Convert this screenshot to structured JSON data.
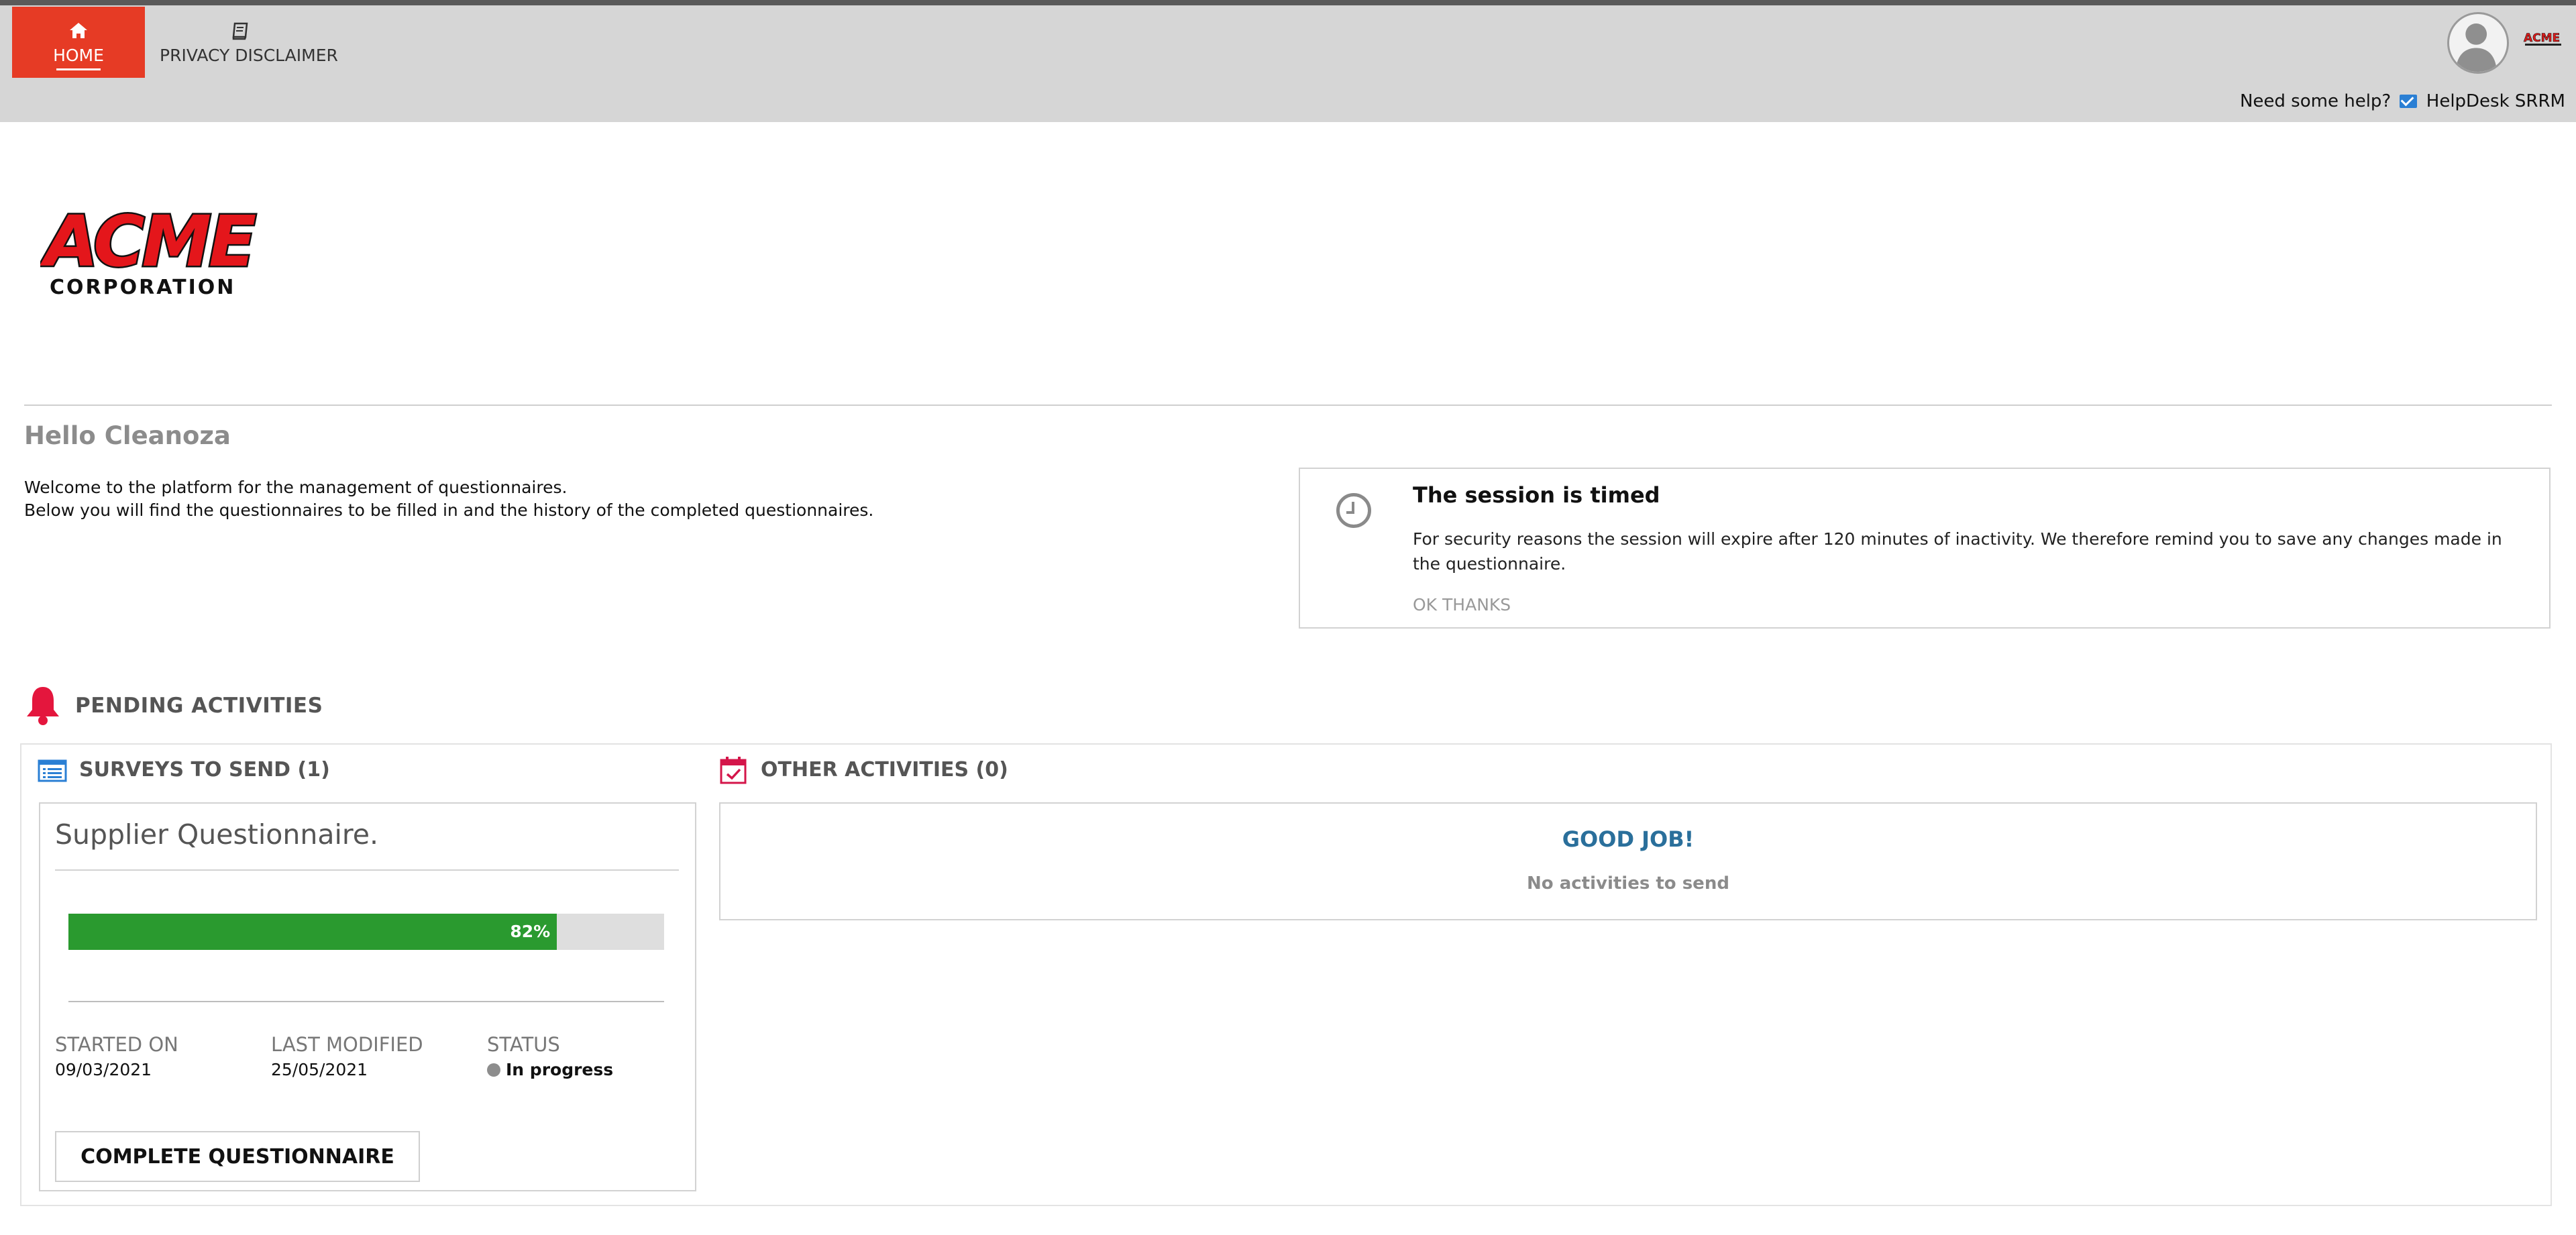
{
  "nav": {
    "home_label": "HOME",
    "privacy_label": "PRIVACY DISCLAIMER"
  },
  "header": {
    "help_text": "Need some help?",
    "helpdesk_label": "HelpDesk SRRM"
  },
  "brand": {
    "logo_line1": "ACME",
    "logo_line2": "CORPORATION",
    "accent": "#e63b25"
  },
  "greeting": {
    "hello": "Hello Cleanoza",
    "line1": "Welcome to the platform for the management of questionnaires.",
    "line2": "Below you will find the questionnaires to be filled in and the history of the completed questionnaires."
  },
  "session": {
    "title": "The session is timed",
    "text": "For security reasons the session will expire after 120 minutes of inactivity. We therefore remind you to save any changes made in the questionnaire.",
    "ok_label": "OK THANKS"
  },
  "pending": {
    "title": "PENDING ACTIVITIES",
    "surveys_title": "SURVEYS TO SEND (1)",
    "other_title": "OTHER ACTIVITIES (0)"
  },
  "survey": {
    "name": "Supplier Questionnaire.",
    "progress_percent": 82,
    "progress_label": "82%",
    "progress_color": "#2a9a2f",
    "started_label": "STARTED ON",
    "started_value": "09/03/2021",
    "modified_label": "LAST MODIFIED",
    "modified_value": "25/05/2021",
    "status_label": "STATUS",
    "status_value": "In progress",
    "button_label": "COMPLETE QUESTIONNAIRE"
  },
  "other": {
    "good_job": "GOOD JOB!",
    "no_activities": "No activities to send"
  }
}
